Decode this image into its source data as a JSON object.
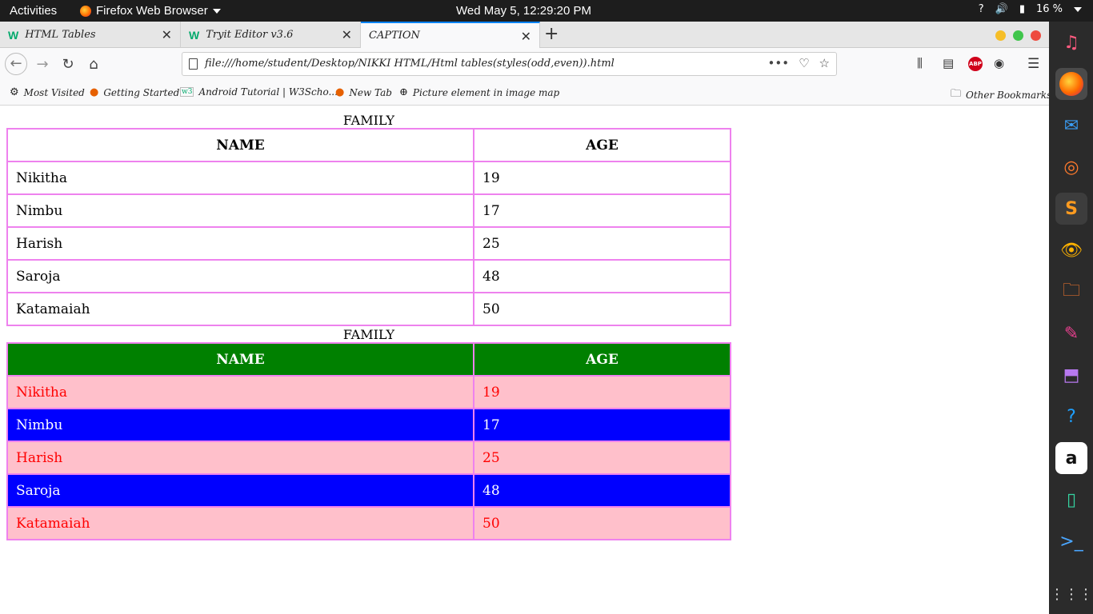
{
  "topbar": {
    "activities": "Activities",
    "app_menu": "Firefox Web Browser",
    "clock": "Wed May  5, 12:29:20 PM",
    "battery": "16 %",
    "help": "?"
  },
  "tabs": [
    {
      "label": "HTML Tables",
      "active": false
    },
    {
      "label": "Tryit Editor v3.6",
      "active": false
    },
    {
      "label": "CAPTION",
      "active": true
    }
  ],
  "url": "file:///home/student/Desktop/NIKKI HTML/Html tables(styles(odd,even)).html",
  "bookmarks": [
    {
      "label": "Most Visited",
      "icon": "gear-icon"
    },
    {
      "label": "Getting Started",
      "icon": "firefox-icon"
    },
    {
      "label": "Android Tutorial | W3Scho...",
      "icon": "w3-icon"
    },
    {
      "label": "New Tab",
      "icon": "firefox-icon"
    },
    {
      "label": "Picture element in image map",
      "icon": "globe-icon"
    }
  ],
  "other_bookmarks": "Other Bookmarks",
  "table1": {
    "caption": "FAMILY",
    "headers": [
      "NAME",
      "AGE"
    ],
    "rows": [
      [
        "Nikitha",
        "19"
      ],
      [
        "Nimbu",
        "17"
      ],
      [
        "Harish",
        "25"
      ],
      [
        "Saroja",
        "48"
      ],
      [
        "Katamaiah",
        "50"
      ]
    ]
  },
  "table2": {
    "caption": "FAMILY",
    "headers": [
      "NAME",
      "AGE"
    ],
    "rows": [
      [
        "Nikitha",
        "19"
      ],
      [
        "Nimbu",
        "17"
      ],
      [
        "Harish",
        "25"
      ],
      [
        "Saroja",
        "48"
      ],
      [
        "Katamaiah",
        "50"
      ]
    ],
    "colors": {
      "header_bg": "#008000",
      "odd_bg": "#ffc0cb",
      "odd_text": "#ff0000",
      "even_bg": "#0000ff",
      "even_text": "#ffffff",
      "border": "#ee82ee"
    }
  }
}
